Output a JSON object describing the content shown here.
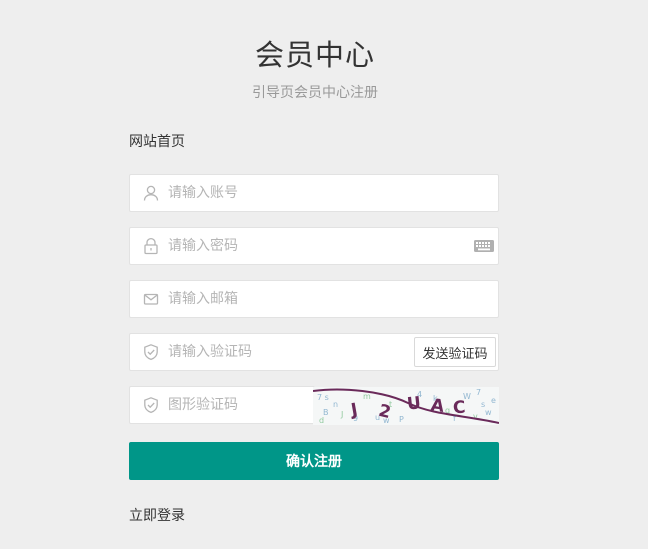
{
  "header": {
    "title": "会员中心",
    "subtitle": "引导页会员中心注册"
  },
  "nav": {
    "home_link": "网站首页"
  },
  "form": {
    "account": {
      "placeholder": "请输入账号",
      "icon": "user-icon"
    },
    "password": {
      "placeholder": "请输入密码",
      "icon": "lock-icon",
      "keyboard_icon": "keyboard-icon"
    },
    "email": {
      "placeholder": "请输入邮箱",
      "icon": "mail-icon"
    },
    "verify_code": {
      "placeholder": "请输入验证码",
      "icon": "shield-icon",
      "send_label": "发送验证码"
    },
    "captcha": {
      "placeholder": "图形验证码",
      "icon": "shield-icon",
      "image_text": "J2UAC"
    },
    "submit_label": "确认注册"
  },
  "footer": {
    "login_link": "立即登录"
  },
  "colors": {
    "accent": "#009688",
    "background": "#eeeeee"
  }
}
